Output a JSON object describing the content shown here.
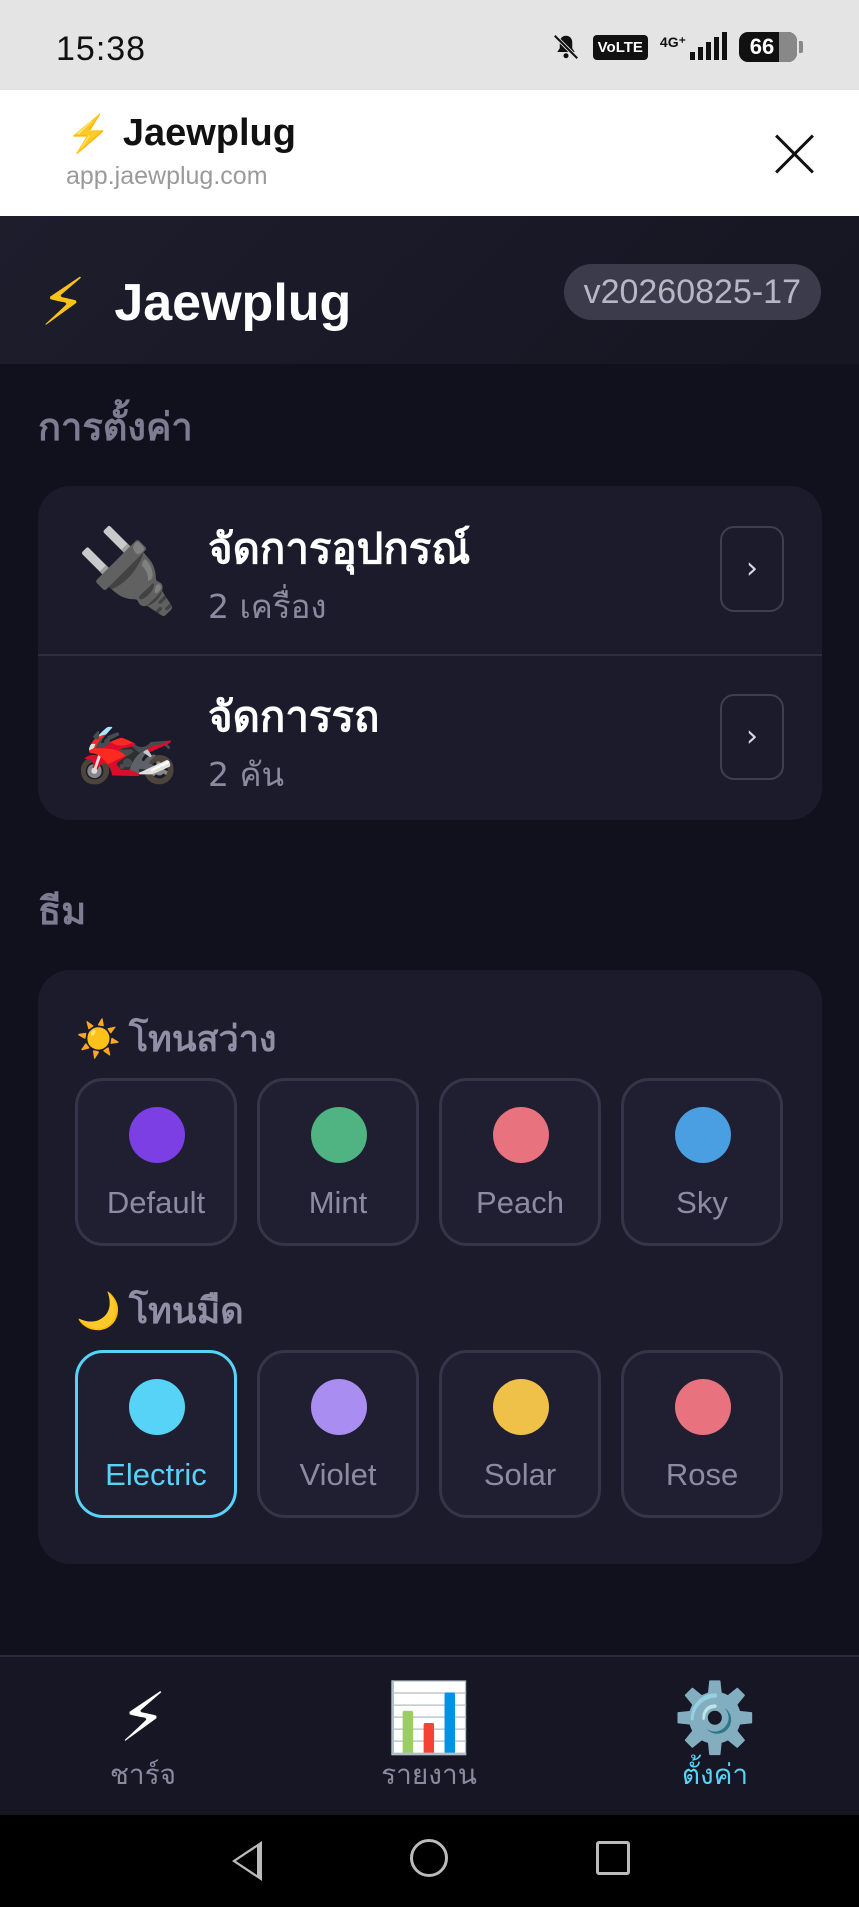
{
  "status_bar": {
    "time": "15:38",
    "volte": "VoLTE",
    "network": "4G⁺",
    "battery": "66",
    "icons": [
      "bell-muted-icon",
      "volte-icon",
      "signal-icon",
      "battery-icon"
    ]
  },
  "browser": {
    "title_icon": "⚡",
    "title": "Jaewplug",
    "url": "app.jaewplug.com"
  },
  "app_header": {
    "logo_icon": "⚡",
    "app_name": "Jaewplug",
    "version": "v20260825-17"
  },
  "settings": {
    "section_title": "การตั้งค่า",
    "rows": [
      {
        "icon": "🔌",
        "title": "จัดการอุปกรณ์",
        "subtitle": "2 เครื่อง",
        "chevron": "›"
      },
      {
        "icon": "🏍️",
        "title": "จัดการรถ",
        "subtitle": "2 คัน",
        "chevron": "›"
      }
    ]
  },
  "theme": {
    "section_title": "ธีม",
    "light": {
      "icon": "☀️",
      "label": "โทนสว่าง",
      "options": [
        {
          "name": "Default",
          "color": "#7b3fe4"
        },
        {
          "name": "Mint",
          "color": "#4fb482"
        },
        {
          "name": "Peach",
          "color": "#e8737f"
        },
        {
          "name": "Sky",
          "color": "#4a9fe3"
        }
      ]
    },
    "dark": {
      "icon": "🌙",
      "label": "โทนมืด",
      "options": [
        {
          "name": "Electric",
          "color": "#56d3f6",
          "selected": true
        },
        {
          "name": "Violet",
          "color": "#a98df0"
        },
        {
          "name": "Solar",
          "color": "#f0c148"
        },
        {
          "name": "Rose",
          "color": "#e8737f"
        }
      ]
    }
  },
  "bottom_nav": [
    {
      "icon": "⚡",
      "label": "ชาร์จ"
    },
    {
      "icon": "📊",
      "label": "รายงาน"
    },
    {
      "icon": "⚙️",
      "label": "ตั้งค่า",
      "active": true
    }
  ],
  "colors": {
    "background": "#11111d",
    "card": "#1b1b2b",
    "accent": "#56d3f6"
  }
}
